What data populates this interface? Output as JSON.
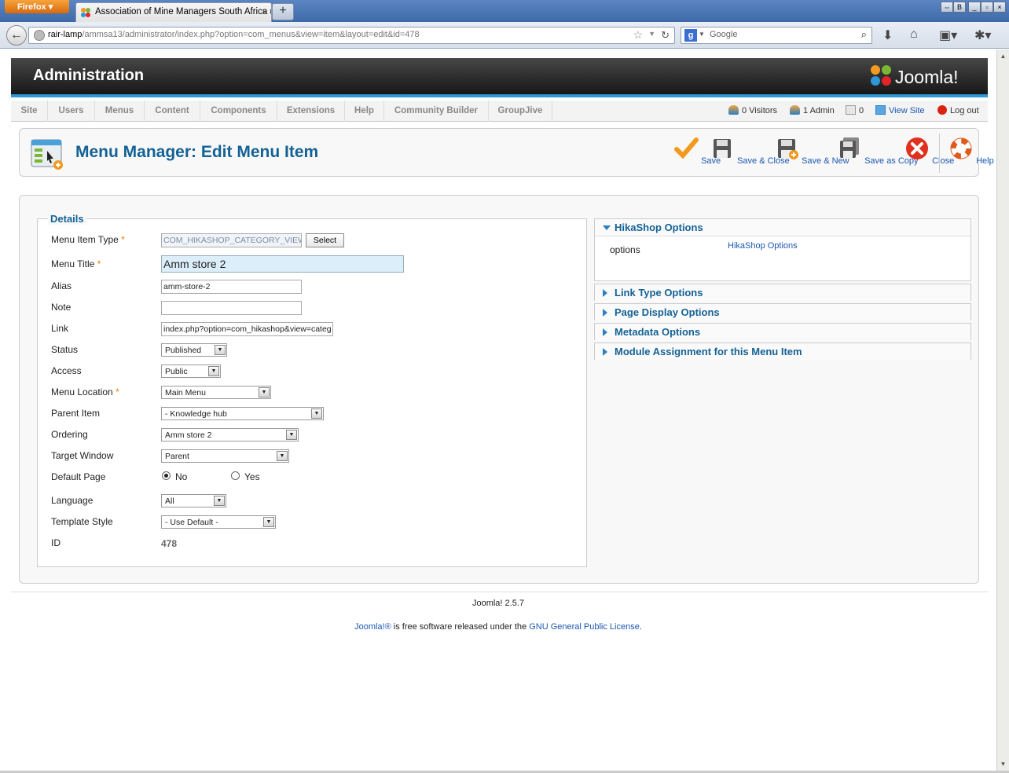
{
  "browser": {
    "menu_button": "Firefox",
    "tab_title": "Association of Mine Managers South Africa (...",
    "url_host": "rair-lamp",
    "url_path": "/ammsa13/administrator/index.php?option=com_menus&view=item&layout=edit&id=478",
    "search_placeholder": "Google"
  },
  "header": {
    "title": "Administration",
    "logo_text": "Joomla!"
  },
  "menu": {
    "items": [
      "Site",
      "Users",
      "Menus",
      "Content",
      "Components",
      "Extensions",
      "Help",
      "Community Builder",
      "GroupJive"
    ]
  },
  "status": {
    "visitors": "0 Visitors",
    "admin": "1 Admin",
    "messages": "0",
    "view_site": "View Site",
    "logout": "Log out"
  },
  "toolbar": {
    "page_title": "Menu Manager: Edit Menu Item",
    "save": "Save",
    "save_close": "Save & Close",
    "save_new": "Save & New",
    "save_copy": "Save as Copy",
    "close": "Close",
    "help": "Help"
  },
  "details": {
    "legend": "Details",
    "menu_item_type_label": "Menu Item Type",
    "menu_item_type_value": "COM_HIKASHOP_CATEGORY_VIEW",
    "select_button": "Select",
    "menu_title_label": "Menu Title",
    "menu_title_value": "Amm store 2",
    "alias_label": "Alias",
    "alias_value": "amm-store-2",
    "note_label": "Note",
    "note_value": "",
    "link_label": "Link",
    "link_value": "index.php?option=com_hikashop&view=categ",
    "status_label": "Status",
    "status_value": "Published",
    "access_label": "Access",
    "access_value": "Public",
    "menu_location_label": "Menu Location",
    "menu_location_value": "Main Menu",
    "parent_item_label": "Parent Item",
    "parent_item_value": "- Knowledge hub",
    "ordering_label": "Ordering",
    "ordering_value": "Amm store 2",
    "target_window_label": "Target Window",
    "target_window_value": "Parent",
    "default_page_label": "Default Page",
    "default_no": "No",
    "default_yes": "Yes",
    "language_label": "Language",
    "language_value": "All",
    "template_style_label": "Template Style",
    "template_style_value": "- Use Default -",
    "id_label": "ID",
    "id_value": "478",
    "required_mark": "*"
  },
  "panels": {
    "hikashop_title": "HikaShop Options",
    "hikashop_option_label": "options",
    "hikashop_option_link": "HikaShop Options",
    "link_type": "Link Type Options",
    "page_display": "Page Display Options",
    "metadata": "Metadata Options",
    "module_assignment": "Module Assignment for this Menu Item"
  },
  "footer": {
    "version": "Joomla! 2.5.7",
    "license_link1": "Joomla!®",
    "license_text": " is free software released under the ",
    "license_link2": "GNU General Public License",
    "license_end": "."
  },
  "colors": {
    "accent": "#146295",
    "link": "#1b57b1",
    "required": "#e48001",
    "header_bar": "#2c98d4"
  }
}
